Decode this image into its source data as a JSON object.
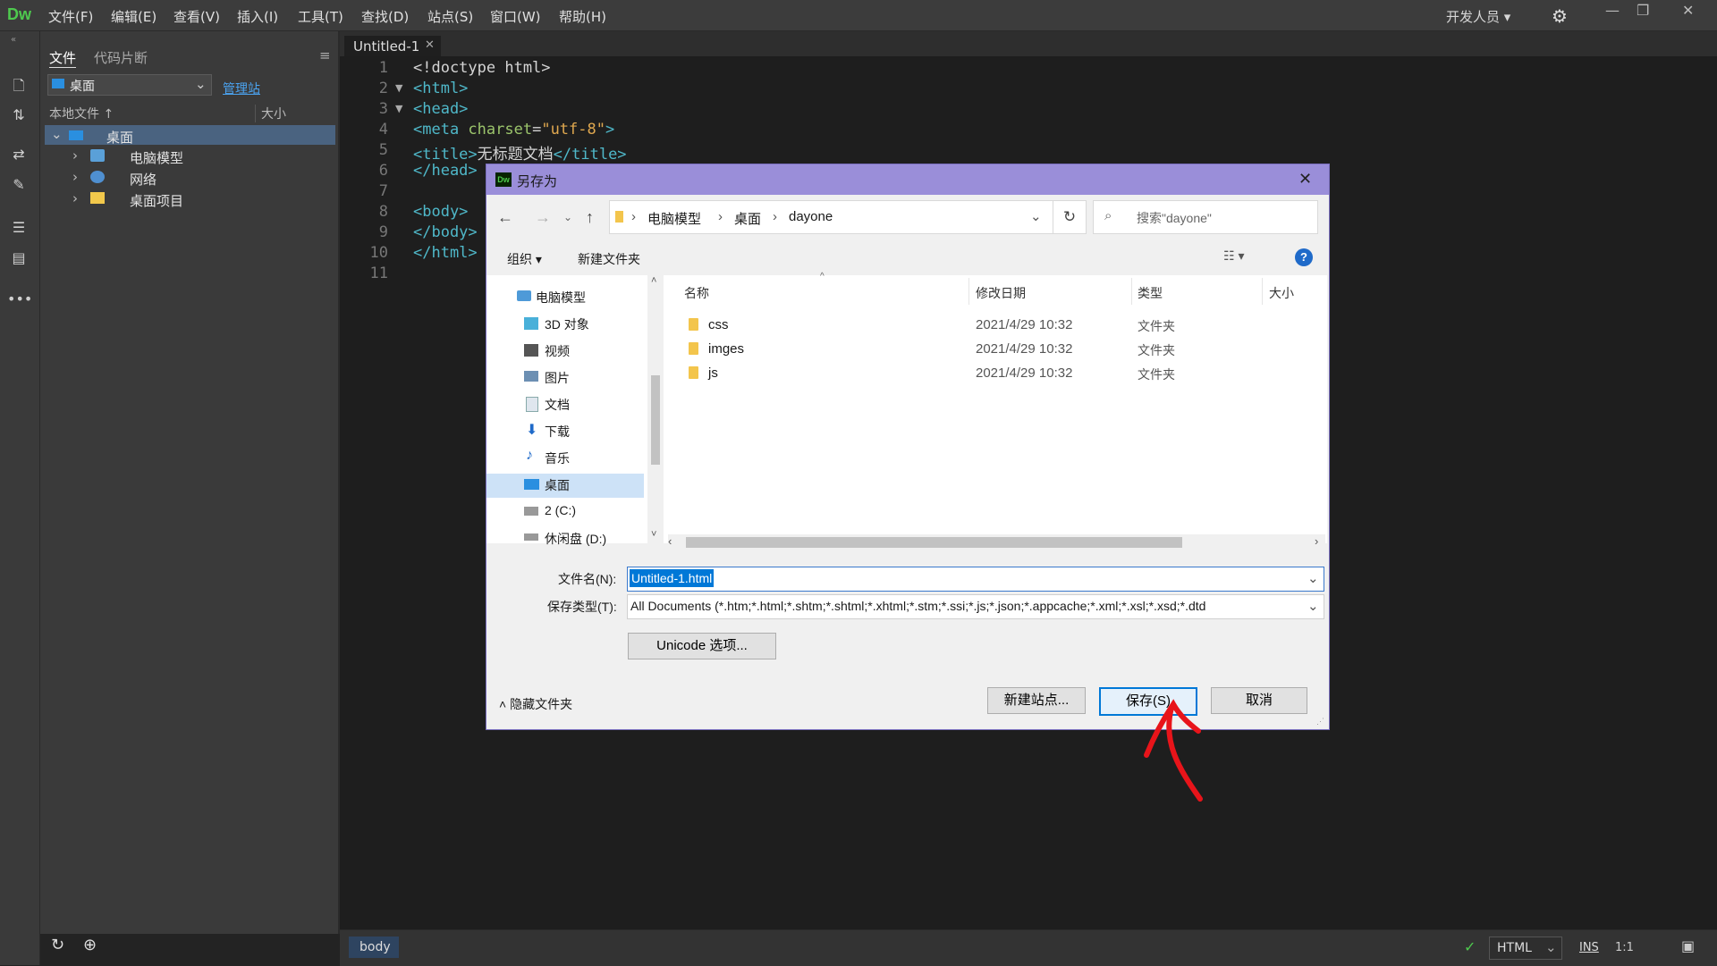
{
  "app": {
    "logo": "Dw"
  },
  "menu": [
    "文件(F)",
    "编辑(E)",
    "查看(V)",
    "插入(I)",
    "工具(T)",
    "查找(D)",
    "站点(S)",
    "窗口(W)",
    "帮助(H)"
  ],
  "workspace": {
    "label": "开发人员"
  },
  "panel": {
    "tabs": [
      "文件",
      "代码片断"
    ],
    "site_select": "桌面",
    "manage_link": "管理站",
    "col_local": "本地文件",
    "col_size": "大小",
    "tree": [
      {
        "label": "桌面",
        "level": 0,
        "icon": "desktop-icon"
      },
      {
        "label": "电脑模型",
        "level": 1,
        "icon": "computer-icon"
      },
      {
        "label": "网络",
        "level": 1,
        "icon": "network-icon"
      },
      {
        "label": "桌面项目",
        "level": 1,
        "icon": "folder-icon"
      }
    ]
  },
  "editor": {
    "tab": "Untitled-1",
    "lines": [
      "1",
      "2",
      "3",
      "4",
      "5",
      "6",
      "7",
      "8",
      "9",
      "10",
      "11"
    ],
    "code": {
      "l1": "<!doctype html>",
      "l2": "<html>",
      "l3": "<head>",
      "l4_a": "<meta ",
      "l4_b": "charset",
      "l4_c": "=",
      "l4_d": "\"utf-8\"",
      "l4_e": ">",
      "l5_a": "<title>",
      "l5_b": "无标题文档",
      "l5_c": "</title>",
      "l6": "</head>",
      "l8": "<body>",
      "l9": "</body>",
      "l10": "</html>"
    }
  },
  "status": {
    "tag": "body",
    "lang": "HTML",
    "mode": "INS",
    "pos": "1:1"
  },
  "dialog": {
    "title": "另存为",
    "breadcrumb": [
      "电脑模型",
      "桌面",
      "dayone"
    ],
    "search_placeholder": "搜索\"dayone\"",
    "organize": "组织 ▾",
    "new_folder": "新建文件夹",
    "nav": [
      {
        "label": "电脑模型",
        "icon": "computer-icon"
      },
      {
        "label": "3D 对象",
        "icon": "cube-icon"
      },
      {
        "label": "视频",
        "icon": "video-icon"
      },
      {
        "label": "图片",
        "icon": "picture-icon"
      },
      {
        "label": "文档",
        "icon": "document-icon"
      },
      {
        "label": "下载",
        "icon": "download-icon"
      },
      {
        "label": "音乐",
        "icon": "music-icon"
      },
      {
        "label": "桌面",
        "icon": "desktop-icon"
      },
      {
        "label": "2 (C:)",
        "icon": "drive-icon"
      },
      {
        "label": "休闲盘 (D:)",
        "icon": "drive-icon"
      }
    ],
    "columns": [
      "名称",
      "修改日期",
      "类型",
      "大小"
    ],
    "files": [
      {
        "name": "css",
        "date": "2021/4/29 10:32",
        "type": "文件夹"
      },
      {
        "name": "imges",
        "date": "2021/4/29 10:32",
        "type": "文件夹"
      },
      {
        "name": "js",
        "date": "2021/4/29 10:32",
        "type": "文件夹"
      }
    ],
    "filename_label": "文件名(N):",
    "filename_value": "Untitled-1.html",
    "type_label": "保存类型(T):",
    "type_value": "All Documents (*.htm;*.html;*.shtm;*.shtml;*.xhtml;*.stm;*.ssi;*.js;*.json;*.appcache;*.xml;*.xsl;*.xsd;*.dtd",
    "unicode_btn": "Unicode 选项...",
    "hide_folders": "隐藏文件夹",
    "new_site_btn": "新建站点...",
    "save_btn": "保存(S)",
    "cancel_btn": "取消"
  },
  "colors": {
    "annotation": "#e8141a",
    "dialog_title": "#9a8ed9",
    "code_tag": "#4fb8c9"
  }
}
